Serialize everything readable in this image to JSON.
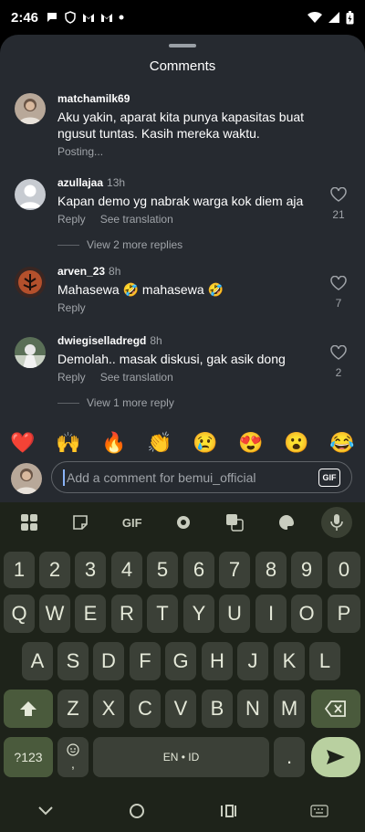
{
  "status": {
    "time": "2:46",
    "icons": [
      "chat-icon",
      "shield-icon",
      "gmail-icon",
      "gmail-icon",
      "dot-icon"
    ],
    "right_icons": [
      "wifi-icon",
      "signal-icon",
      "battery-icon"
    ]
  },
  "sheet": {
    "title": "Comments"
  },
  "comments": [
    {
      "user": "matchamilk69",
      "ago": "",
      "text": "Aku yakin, aparat kita punya kapasitas buat ngusut tuntas. Kasih mereka waktu.",
      "status": "Posting...",
      "likes": ""
    },
    {
      "user": "azullajaa",
      "ago": "13h",
      "text": "Kapan demo yg nabrak warga kok diem aja",
      "reply": "Reply",
      "translate": "See translation",
      "likes": "21",
      "more": "View 2 more replies"
    },
    {
      "user": "arven_23",
      "ago": "8h",
      "text": "Mahasewa 🤣 mahasewa 🤣",
      "reply": "Reply",
      "likes": "7"
    },
    {
      "user": "dwiegiselladregd",
      "ago": "8h",
      "text": "Demolah.. masak diskusi, gak asik dong",
      "reply": "Reply",
      "translate": "See translation",
      "likes": "2",
      "more": "View 1 more reply"
    }
  ],
  "emojis": [
    "❤️",
    "🙌",
    "🔥",
    "👏",
    "😢",
    "😍",
    "😮",
    "😂"
  ],
  "composer": {
    "placeholder": "Add a comment for bemui_official",
    "gif": "GIF"
  },
  "keyboard": {
    "toolbar": [
      "apps-icon",
      "sticker-icon",
      "GIF",
      "settings-icon",
      "translate-icon",
      "palette-icon",
      "mic-icon"
    ],
    "row1": [
      "1",
      "2",
      "3",
      "4",
      "5",
      "6",
      "7",
      "8",
      "9",
      "0"
    ],
    "row2": [
      "Q",
      "W",
      "E",
      "R",
      "T",
      "Y",
      "U",
      "I",
      "O",
      "P"
    ],
    "row3": [
      "A",
      "S",
      "D",
      "F",
      "G",
      "H",
      "J",
      "K",
      "L"
    ],
    "row4": [
      "Z",
      "X",
      "C",
      "V",
      "B",
      "N",
      "M"
    ],
    "sym": "?123",
    "comma": ",",
    "space": "EN • ID",
    "period": "."
  },
  "colors": {
    "sheet_bg": "#262a30",
    "keyboard_bg": "#1e231a",
    "key_bg": "#3b4037",
    "accent": "#b9d0a0"
  }
}
